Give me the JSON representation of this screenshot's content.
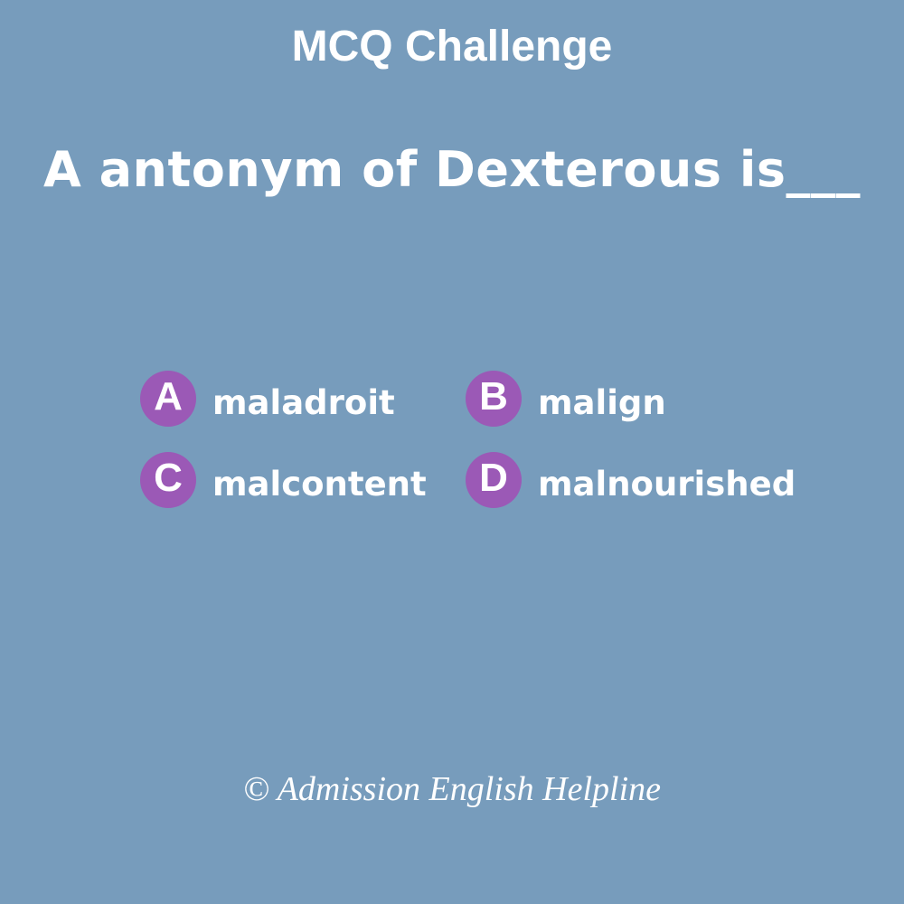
{
  "header": {
    "title": "MCQ Challenge"
  },
  "question": {
    "text": "A antonym of Dexterous is___"
  },
  "options": [
    {
      "letter": "A",
      "text": "maladroit"
    },
    {
      "letter": "B",
      "text": "malign"
    },
    {
      "letter": "C",
      "text": "malcontent"
    },
    {
      "letter": "D",
      "text": "malnourished"
    }
  ],
  "footer": {
    "copyright": "© Admission English Helpline"
  },
  "colors": {
    "background": "#779cbc",
    "badge": "#9b59b6",
    "text": "#ffffff"
  }
}
